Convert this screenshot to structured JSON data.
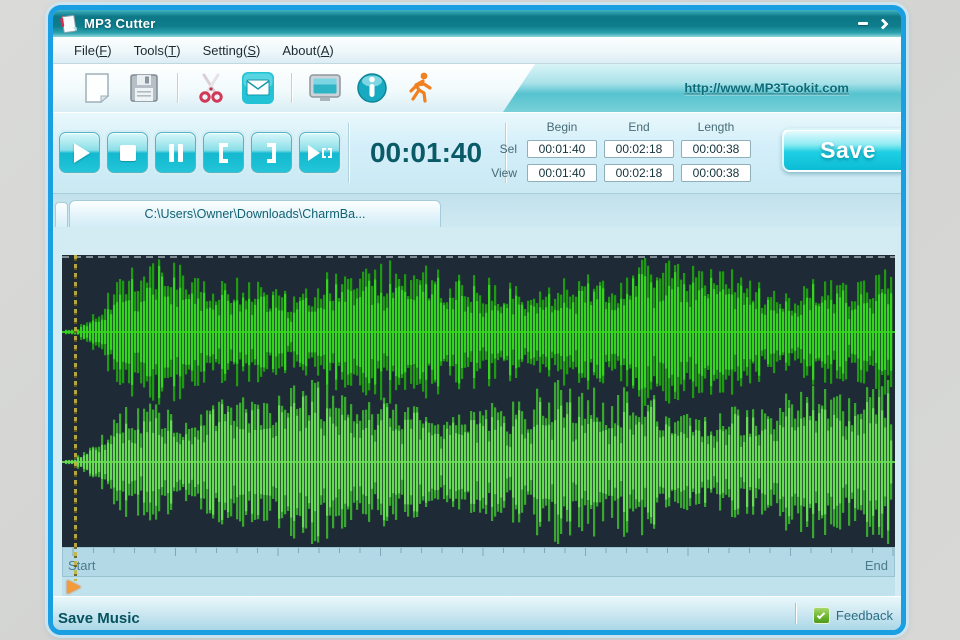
{
  "window": {
    "title": "MP3 Cutter"
  },
  "menu": {
    "items": [
      {
        "pre": "File(",
        "key": "F",
        "post": ")"
      },
      {
        "pre": "Tools(",
        "key": "T",
        "post": ")"
      },
      {
        "pre": "Setting(",
        "key": "S",
        "post": ")"
      },
      {
        "pre": "About(",
        "key": "A",
        "post": ")"
      }
    ]
  },
  "toolbar": {
    "link": "http://www.MP3Tookit.com"
  },
  "transport": {
    "time": "00:01:40"
  },
  "seltable": {
    "headers": [
      "Begin",
      "End",
      "Length"
    ],
    "rows": [
      {
        "label": "Sel",
        "values": [
          "00:01:40",
          "00:02:18",
          "00:00:38"
        ]
      },
      {
        "label": "View",
        "values": [
          "00:01:40",
          "00:02:18",
          "00:00:38"
        ]
      }
    ]
  },
  "save_button": "Save",
  "tab": {
    "path": "C:\\Users\\Owner\\Downloads\\CharmBa..."
  },
  "timeline": {
    "start": "Start",
    "end": "End"
  },
  "status": {
    "left": "Save Music",
    "feedback": "Feedback"
  },
  "colors": {
    "frame_blue": "#1b9fe3",
    "titlebar_teal": "#0e7d8c",
    "link_teal": "#0b6b78"
  },
  "waveform": {
    "bg": "#1e2b37",
    "top_back": "#1f9a12",
    "top_front": "#35d51f",
    "bottom_back": "#3aa830",
    "bottom_front": "#68da55",
    "marker": "#c4b440",
    "tick": "#7fa9ba"
  }
}
